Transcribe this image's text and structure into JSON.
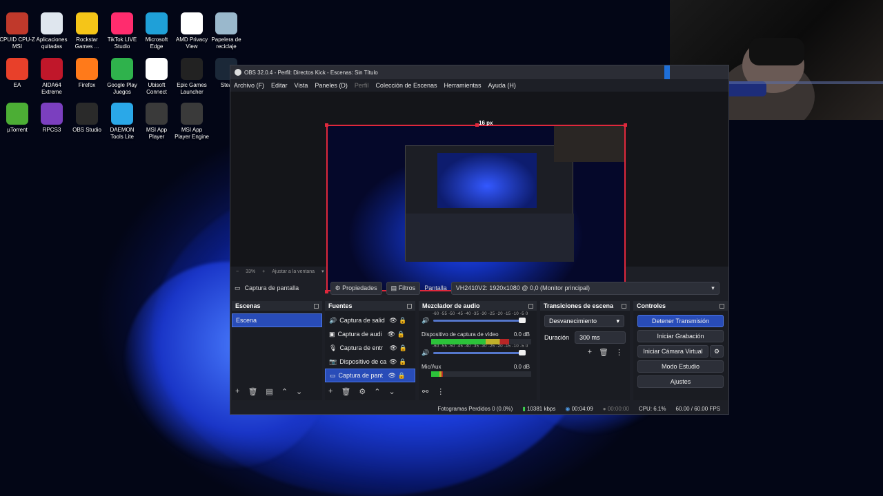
{
  "desktop": {
    "icons": [
      {
        "label": "CPUID CPU-Z MSI",
        "icon": "cpuz-icon",
        "color": "#c0392b"
      },
      {
        "label": "Aplicaciones quitadas",
        "icon": "document-icon",
        "color": "#dfe6ee"
      },
      {
        "label": "Rockstar Games ...",
        "icon": "rockstar-icon",
        "color": "#f5c518"
      },
      {
        "label": "TikTok LIVE Studio",
        "icon": "tiktok-icon",
        "color": "#ff2c6e"
      },
      {
        "label": "Microsoft Edge",
        "icon": "edge-icon",
        "color": "#1fa0d8"
      },
      {
        "label": "AMD Privacy View",
        "icon": "eye-icon",
        "color": "#ffffff"
      },
      {
        "label": "Papelera de reciclaje",
        "icon": "recycle-bin-icon",
        "color": "#9ab8cc"
      },
      {
        "label": "EA",
        "icon": "ea-icon",
        "color": "#e8402a"
      },
      {
        "label": "AIDA64 Extreme",
        "icon": "aida64-icon",
        "color": "#c0172a"
      },
      {
        "label": "Firefox",
        "icon": "firefox-icon",
        "color": "#ff7a1a"
      },
      {
        "label": "Google Play Juegos",
        "icon": "play-games-icon",
        "color": "#2fb24c"
      },
      {
        "label": "Ubisoft Connect",
        "icon": "ubisoft-icon",
        "color": "#ffffff"
      },
      {
        "label": "Epic Games Launcher",
        "icon": "epic-icon",
        "color": "#222222"
      },
      {
        "label": "Stea",
        "icon": "steam-icon",
        "color": "#1b2838"
      },
      {
        "label": "µTorrent",
        "icon": "utorrent-icon",
        "color": "#4cae35"
      },
      {
        "label": "RPCS3",
        "icon": "rpcs3-icon",
        "color": "#7b3fbf"
      },
      {
        "label": "OBS Studio",
        "icon": "obs-icon",
        "color": "#2a2a2a"
      },
      {
        "label": "DAEMON Tools Lite",
        "icon": "daemon-icon",
        "color": "#2aa8e8"
      },
      {
        "label": "MSI App Player",
        "icon": "msi-app-icon",
        "color": "#3a3a3a"
      },
      {
        "label": "MSI App Player Engine",
        "icon": "msi-engine-icon",
        "color": "#3a3a3a"
      }
    ]
  },
  "obs": {
    "title": "OBS 32.0.4 - Perfil: Directos Kick - Escenas: Sin Título",
    "menu": [
      "Archivo (F)",
      "Editar",
      "Vista",
      "Paneles (D)",
      "Perfil",
      "Colección de Escenas",
      "Herramientas",
      "Ayuda (H)"
    ],
    "preview": {
      "px_label": "16 px",
      "zoom_minus": "−",
      "zoom": "33%",
      "zoom_plus": "+",
      "fit": "Ajustar a la ventana"
    },
    "source_bar": {
      "source_name": "Captura de pantalla",
      "properties": "Propiedades",
      "filters": "Filtros",
      "display_label": "Pantalla",
      "display_value": "VH2410V2: 1920x1080 @ 0,0 (Monitor principal)"
    },
    "scenes": {
      "title": "Escenas",
      "items": [
        "Escena"
      ]
    },
    "sources": {
      "title": "Fuentes",
      "items": [
        {
          "label": "Captura de salid",
          "icon": "speaker-icon"
        },
        {
          "label": "Captura de audi",
          "icon": "window-icon"
        },
        {
          "label": "Captura de entr",
          "icon": "microphone-icon"
        },
        {
          "label": "Dispositivo de ca",
          "icon": "camera-icon"
        },
        {
          "label": "Captura de pant",
          "icon": "monitor-icon"
        }
      ]
    },
    "mixer": {
      "title": "Mezclador de audio",
      "scale": "-60 -55 -50 -45 -40 -35 -30 -25 -20 -15 -10 -5 0",
      "channels": [
        {
          "name": "Dispositivo de captura de vídeo",
          "db": "0.0 dB",
          "level": 0.78
        },
        {
          "name": "Mic/Aux",
          "db": "0.0 dB",
          "level": 0.12
        }
      ]
    },
    "transitions": {
      "title": "Transiciones de escena",
      "selected": "Desvanecimiento",
      "duration_label": "Duración",
      "duration_value": "300 ms"
    },
    "controls": {
      "title": "Controles",
      "stop_stream": "Detener Transmisión",
      "start_recording": "Iniciar Grabación",
      "virtual_camera": "Iniciar Cámara Virtual",
      "studio_mode": "Modo Estudio",
      "settings": "Ajustes"
    },
    "status": {
      "dropped_frames": "Fotogramas Perdidos 0 (0.0%)",
      "bitrate": "10381 kbps",
      "stream_time": "00:04:09",
      "record_time": "00:00:00",
      "cpu": "CPU: 6.1%",
      "fps": "60.00 / 60.00 FPS"
    }
  }
}
